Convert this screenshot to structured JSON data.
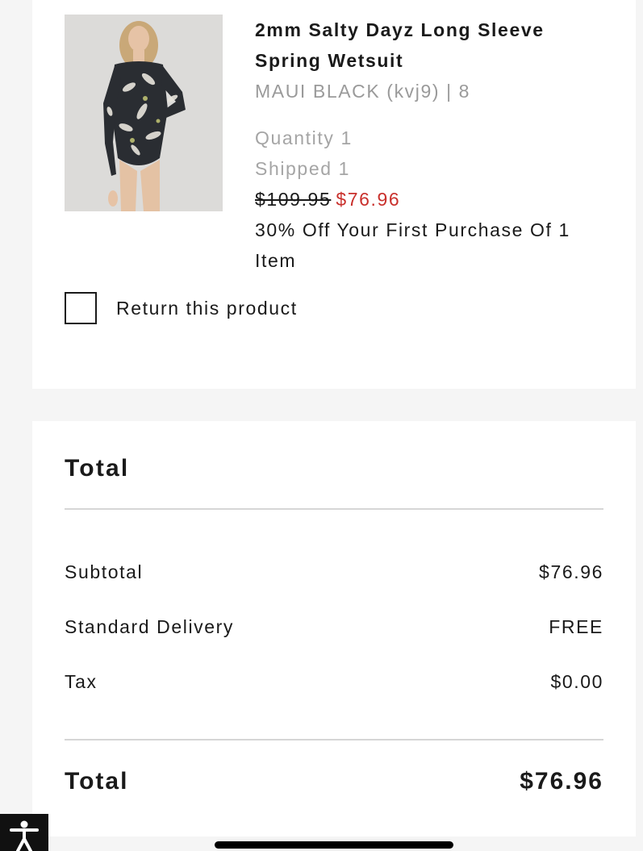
{
  "product": {
    "title": "2mm Salty Dayz Long Sleeve Spring Wetsuit",
    "variant": "MAUI BLACK (kvj9) | 8",
    "quantity": "Quantity 1",
    "shipped": "Shipped 1",
    "original_price": "$109.95",
    "sale_price": "$76.96",
    "promotion": "30% Off Your First Purchase Of 1 Item",
    "return_label": "Return this product",
    "return_checked": false
  },
  "totals": {
    "heading": "Total",
    "rows": [
      {
        "label": "Subtotal",
        "value": "$76.96"
      },
      {
        "label": "Standard Delivery",
        "value": "FREE"
      },
      {
        "label": "Tax",
        "value": "$0.00"
      }
    ],
    "grand_total_label": "Total",
    "grand_total_value": "$76.96"
  },
  "colors": {
    "sale_price": "#c9302c",
    "muted_text": "#a5a5a5",
    "page_background": "#f5f5f5",
    "card_background": "#ffffff"
  },
  "icons": {
    "accessibility": "accessibility-icon"
  }
}
